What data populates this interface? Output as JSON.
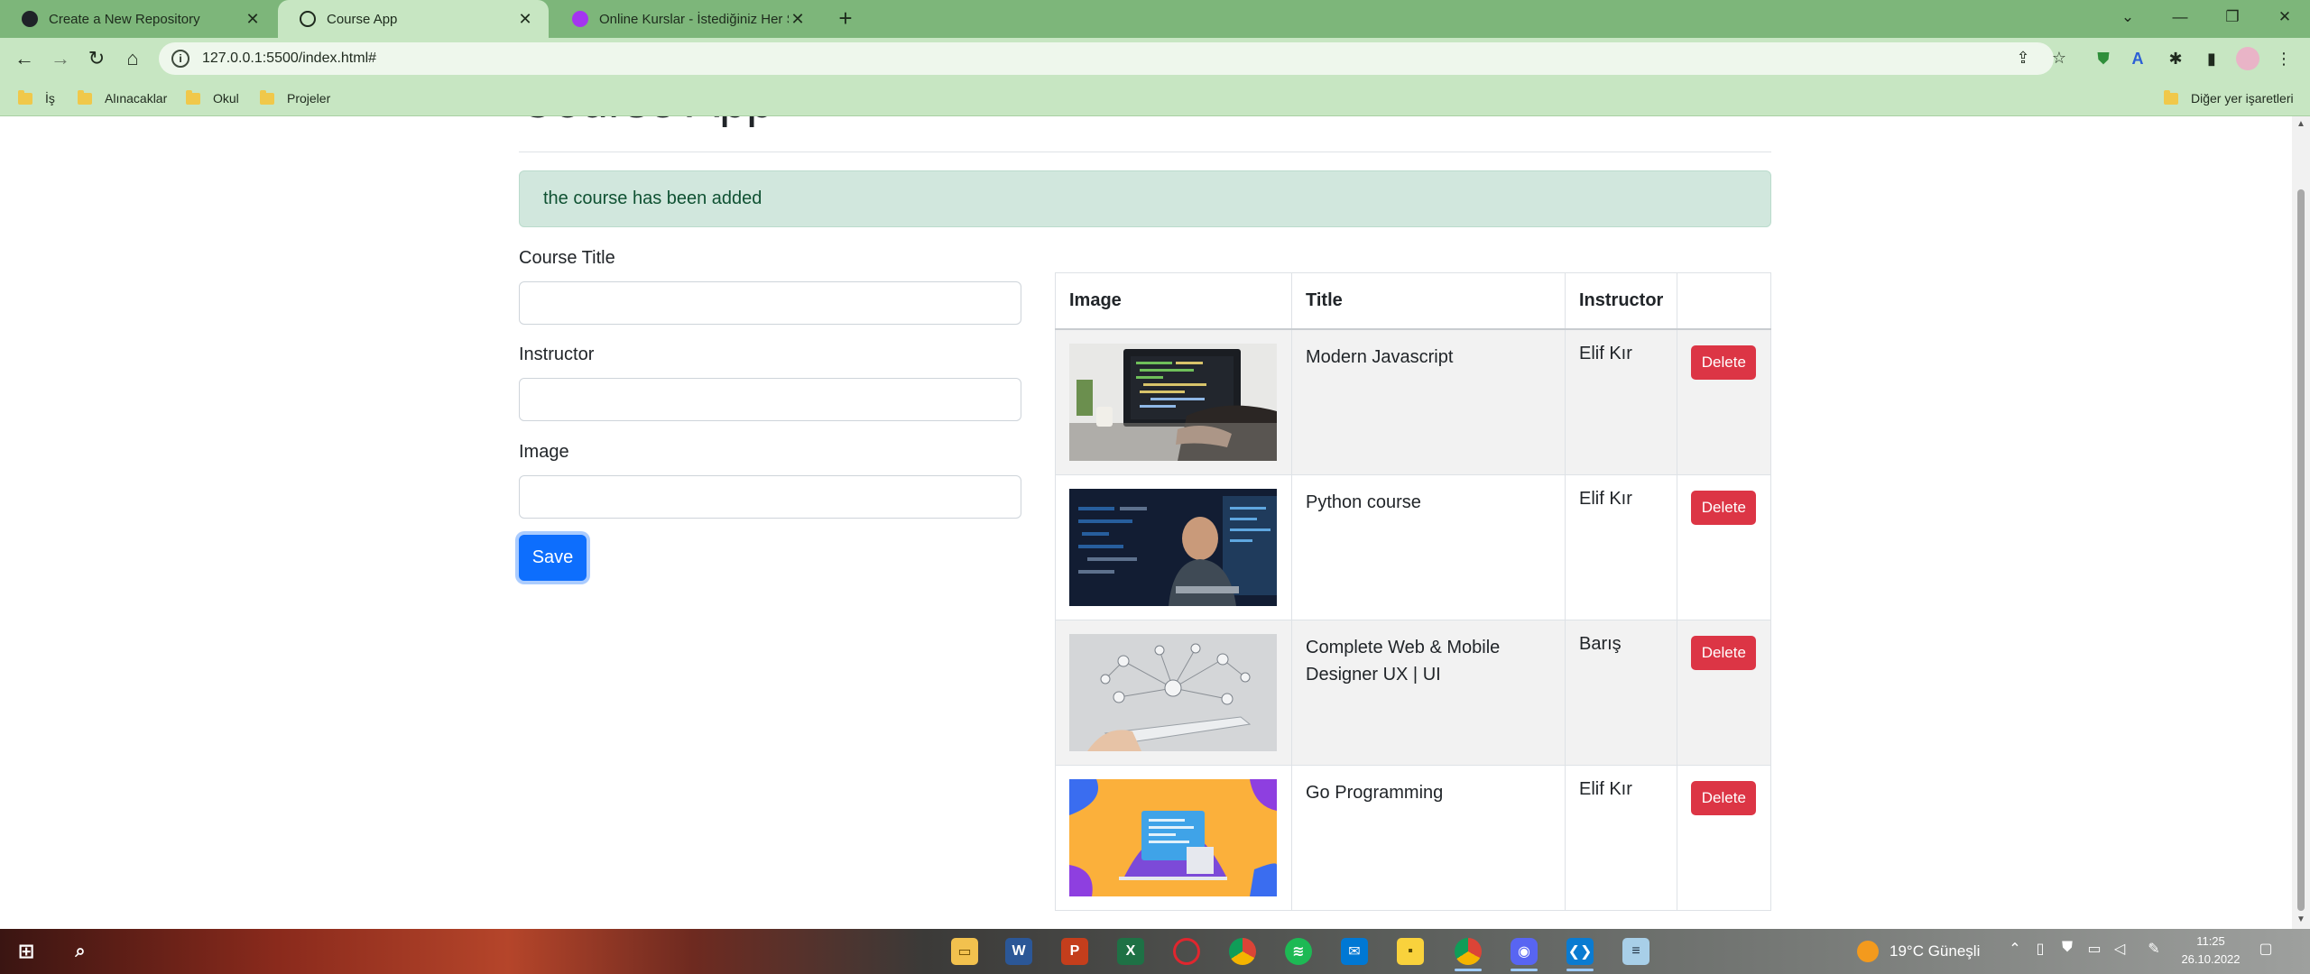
{
  "browser": {
    "tabs": [
      {
        "label": "Create a New Repository",
        "icon": "github-icon"
      },
      {
        "label": "Course App",
        "icon": "globe-icon"
      },
      {
        "label": "Online Kurslar - İstediğiniz Her Ş",
        "icon": "udemy-icon"
      }
    ],
    "url": "127.0.0.1:5500/index.html#",
    "bookmarks": [
      "İş",
      "Alınacaklar",
      "Okul",
      "Projeler"
    ],
    "other_bookmarks": "Diğer yer işaretleri"
  },
  "page": {
    "title": "Course App",
    "alert": "the course has been added",
    "form": {
      "title_label": "Course Title",
      "title_value": "",
      "instructor_label": "Instructor",
      "instructor_value": "",
      "image_label": "Image",
      "image_value": "",
      "save_label": "Save"
    },
    "table": {
      "headers": [
        "Image",
        "Title",
        "Instructor",
        ""
      ],
      "rows": [
        {
          "title": "Modern Javascript",
          "instructor": "Elif Kır",
          "delete_label": "Delete"
        },
        {
          "title": "Python course",
          "instructor": "Elif Kır",
          "delete_label": "Delete"
        },
        {
          "title": "Complete Web & Mobile Designer UX | UI",
          "instructor": "Barış",
          "delete_label": "Delete"
        },
        {
          "title": "Go Programming",
          "instructor": "Elif Kır",
          "delete_label": "Delete"
        }
      ]
    }
  },
  "taskbar": {
    "weather": "19°C  Güneşli",
    "time": "11:25",
    "date": "26.10.2022"
  },
  "colors": {
    "chrome_frame": "#7db67a",
    "chrome_toolbar": "#c7e6c2",
    "primary": "#0d6efd",
    "danger": "#dc3545",
    "alert_bg": "#d1e7dd",
    "alert_text": "#0f5132"
  }
}
